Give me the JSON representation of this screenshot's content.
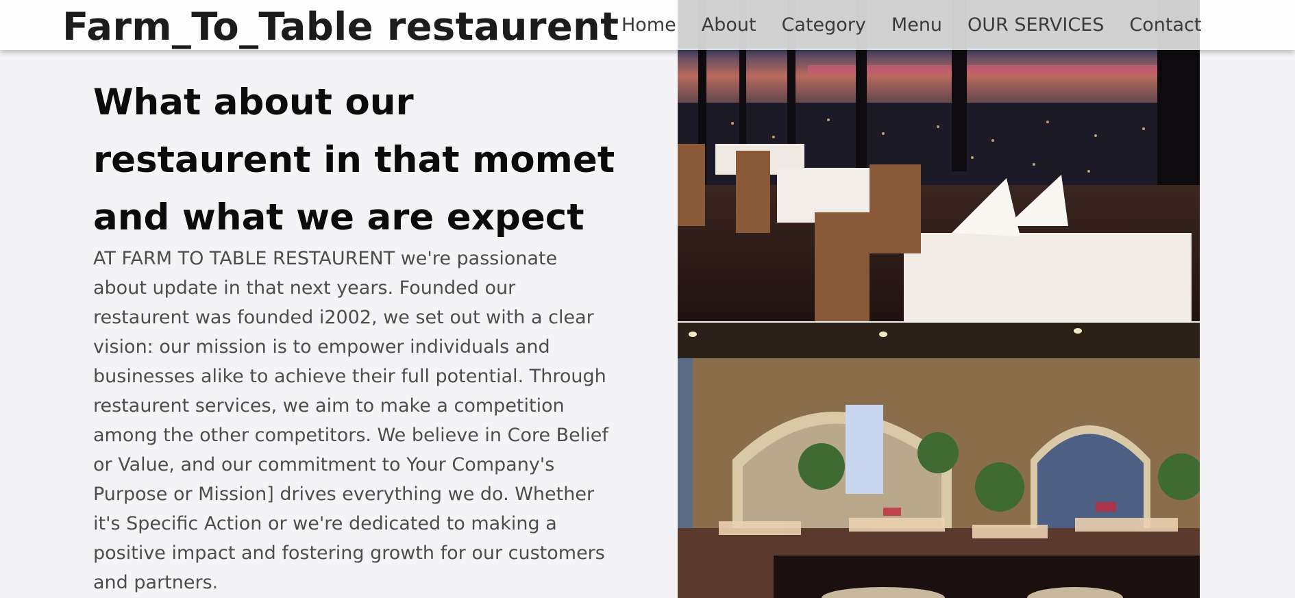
{
  "site": {
    "title": "Farm_To_Table restaurent"
  },
  "nav": {
    "items": [
      "Home",
      "About",
      "Category",
      "Menu",
      "OUR SERVICES",
      "Contact"
    ]
  },
  "about": {
    "heading": "What about our restaurent in that momet and what we are expect",
    "body": "AT FARM TO TABLE RESTAURENT we're passionate about update in that next years. Founded our restaurent was founded i2002, we set out with a clear vision: our mission is to empower individuals and businesses alike to achieve their full potential. Through restaurent services, we aim to make a competition among the other competitors. We believe in Core Belief or Value, and our commitment to Your Company's Purpose or Mission] drives everything we do. Whether it's Specific Action or we're dedicated to making a positive impact and fostering growth for our customers and partners."
  },
  "images": [
    "dining-room-city-view",
    "arched-dining-hall"
  ],
  "colors": {
    "background": "#f4f4f7",
    "header": "#ffffff",
    "heading": "#0b0b0b",
    "body": "#4d4d4d"
  }
}
